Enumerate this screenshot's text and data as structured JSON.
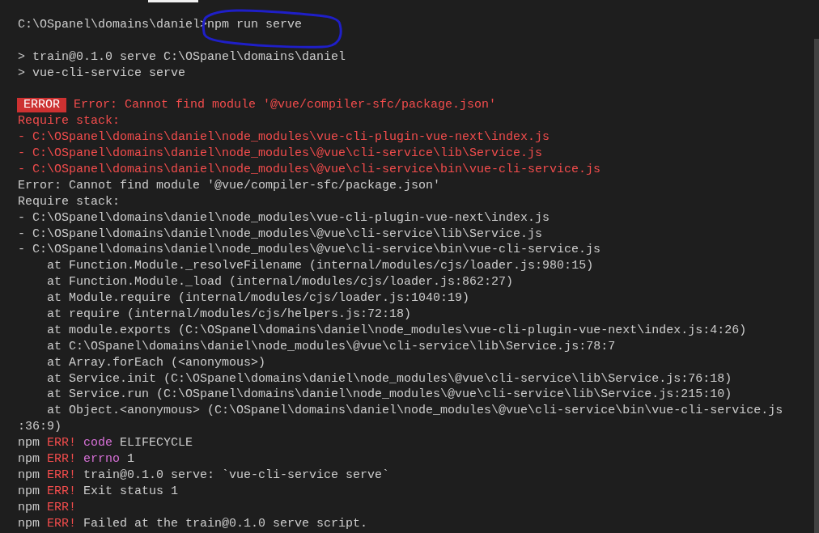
{
  "terminal": {
    "lines": [
      {
        "kind": "text",
        "segments": [
          {
            "kind": "prompt",
            "text": "C:\\OSpanel\\domains\\daniel>"
          },
          {
            "kind": "command",
            "text": "npm run serve"
          }
        ]
      },
      {
        "kind": "blank"
      },
      {
        "kind": "text",
        "segments": [
          {
            "kind": "plain",
            "text": "> train@0.1.0 serve C:\\OSpanel\\domains\\daniel"
          }
        ]
      },
      {
        "kind": "text",
        "segments": [
          {
            "kind": "plain",
            "text": "> vue-cli-service serve"
          }
        ]
      },
      {
        "kind": "blank"
      },
      {
        "kind": "text",
        "segments": [
          {
            "kind": "badge",
            "text": "ERROR"
          },
          {
            "kind": "red",
            "text": " Error: Cannot find module '@vue/compiler-sfc/package.json'"
          }
        ]
      },
      {
        "kind": "text",
        "segments": [
          {
            "kind": "red",
            "text": "Require stack:"
          }
        ]
      },
      {
        "kind": "text",
        "segments": [
          {
            "kind": "red",
            "text": "- C:\\OSpanel\\domains\\daniel\\node_modules\\vue-cli-plugin-vue-next\\index.js"
          }
        ]
      },
      {
        "kind": "text",
        "segments": [
          {
            "kind": "red",
            "text": "- C:\\OSpanel\\domains\\daniel\\node_modules\\@vue\\cli-service\\lib\\Service.js"
          }
        ]
      },
      {
        "kind": "text",
        "segments": [
          {
            "kind": "red",
            "text": "- C:\\OSpanel\\domains\\daniel\\node_modules\\@vue\\cli-service\\bin\\vue-cli-service.js"
          }
        ]
      },
      {
        "kind": "text",
        "segments": [
          {
            "kind": "plain",
            "text": "Error: Cannot find module '@vue/compiler-sfc/package.json'"
          }
        ]
      },
      {
        "kind": "text",
        "segments": [
          {
            "kind": "plain",
            "text": "Require stack:"
          }
        ]
      },
      {
        "kind": "text",
        "segments": [
          {
            "kind": "plain",
            "text": "- C:\\OSpanel\\domains\\daniel\\node_modules\\vue-cli-plugin-vue-next\\index.js"
          }
        ]
      },
      {
        "kind": "text",
        "segments": [
          {
            "kind": "plain",
            "text": "- C:\\OSpanel\\domains\\daniel\\node_modules\\@vue\\cli-service\\lib\\Service.js"
          }
        ]
      },
      {
        "kind": "text",
        "segments": [
          {
            "kind": "plain",
            "text": "- C:\\OSpanel\\domains\\daniel\\node_modules\\@vue\\cli-service\\bin\\vue-cli-service.js"
          }
        ]
      },
      {
        "kind": "text",
        "segments": [
          {
            "kind": "plain",
            "text": "    at Function.Module._resolveFilename (internal/modules/cjs/loader.js:980:15)"
          }
        ]
      },
      {
        "kind": "text",
        "segments": [
          {
            "kind": "plain",
            "text": "    at Function.Module._load (internal/modules/cjs/loader.js:862:27)"
          }
        ]
      },
      {
        "kind": "text",
        "segments": [
          {
            "kind": "plain",
            "text": "    at Module.require (internal/modules/cjs/loader.js:1040:19)"
          }
        ]
      },
      {
        "kind": "text",
        "segments": [
          {
            "kind": "plain",
            "text": "    at require (internal/modules/cjs/helpers.js:72:18)"
          }
        ]
      },
      {
        "kind": "text",
        "segments": [
          {
            "kind": "plain",
            "text": "    at module.exports (C:\\OSpanel\\domains\\daniel\\node_modules\\vue-cli-plugin-vue-next\\index.js:4:26)"
          }
        ]
      },
      {
        "kind": "text",
        "segments": [
          {
            "kind": "plain",
            "text": "    at C:\\OSpanel\\domains\\daniel\\node_modules\\@vue\\cli-service\\lib\\Service.js:78:7"
          }
        ]
      },
      {
        "kind": "text",
        "segments": [
          {
            "kind": "plain",
            "text": "    at Array.forEach (<anonymous>)"
          }
        ]
      },
      {
        "kind": "text",
        "segments": [
          {
            "kind": "plain",
            "text": "    at Service.init (C:\\OSpanel\\domains\\daniel\\node_modules\\@vue\\cli-service\\lib\\Service.js:76:18)"
          }
        ]
      },
      {
        "kind": "text",
        "segments": [
          {
            "kind": "plain",
            "text": "    at Service.run (C:\\OSpanel\\domains\\daniel\\node_modules\\@vue\\cli-service\\lib\\Service.js:215:10)"
          }
        ]
      },
      {
        "kind": "text",
        "segments": [
          {
            "kind": "plain",
            "text": "    at Object.<anonymous> (C:\\OSpanel\\domains\\daniel\\node_modules\\@vue\\cli-service\\bin\\vue-cli-service.js"
          }
        ]
      },
      {
        "kind": "text",
        "segments": [
          {
            "kind": "plain",
            "text": ":36:9)"
          }
        ]
      },
      {
        "kind": "text",
        "segments": [
          {
            "kind": "plain",
            "text": "npm"
          },
          {
            "kind": "red",
            "text": " ERR!"
          },
          {
            "kind": "magenta",
            "text": " code"
          },
          {
            "kind": "plain",
            "text": " ELIFECYCLE"
          }
        ]
      },
      {
        "kind": "text",
        "segments": [
          {
            "kind": "plain",
            "text": "npm"
          },
          {
            "kind": "red",
            "text": " ERR!"
          },
          {
            "kind": "magenta",
            "text": " errno"
          },
          {
            "kind": "plain",
            "text": " 1"
          }
        ]
      },
      {
        "kind": "text",
        "segments": [
          {
            "kind": "plain",
            "text": "npm"
          },
          {
            "kind": "red",
            "text": " ERR!"
          },
          {
            "kind": "plain",
            "text": " train@0.1.0 serve: `vue-cli-service serve`"
          }
        ]
      },
      {
        "kind": "text",
        "segments": [
          {
            "kind": "plain",
            "text": "npm"
          },
          {
            "kind": "red",
            "text": " ERR!"
          },
          {
            "kind": "plain",
            "text": " Exit status 1"
          }
        ]
      },
      {
        "kind": "text",
        "segments": [
          {
            "kind": "plain",
            "text": "npm"
          },
          {
            "kind": "red",
            "text": " ERR!"
          }
        ]
      },
      {
        "kind": "text",
        "segments": [
          {
            "kind": "plain",
            "text": "npm"
          },
          {
            "kind": "red",
            "text": " ERR!"
          },
          {
            "kind": "plain",
            "text": " Failed at the train@0.1.0 serve script."
          }
        ]
      }
    ]
  }
}
